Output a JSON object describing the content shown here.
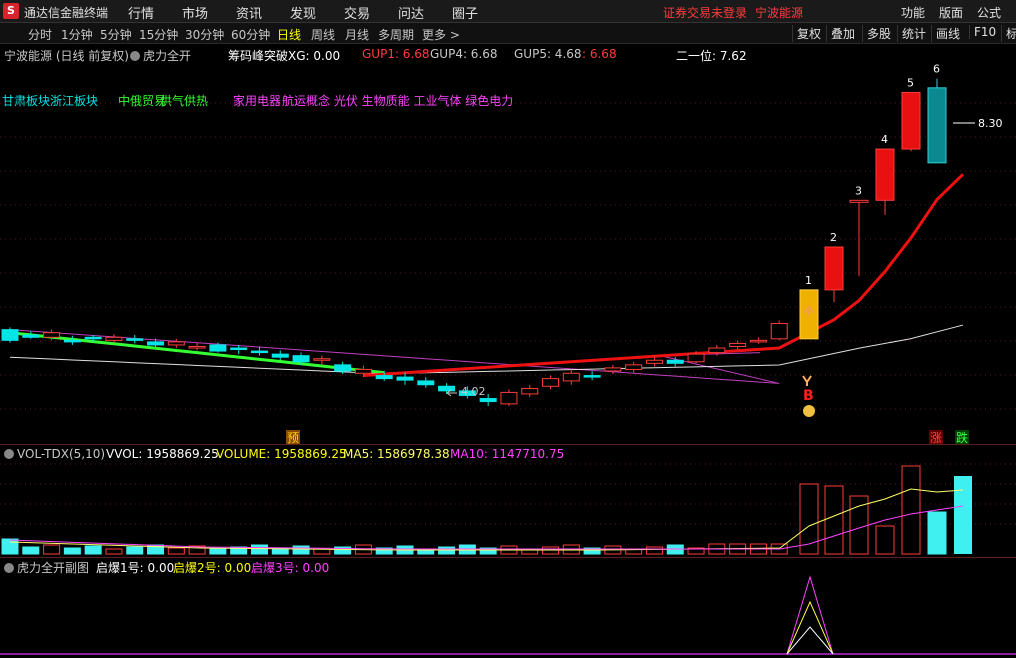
{
  "menubar": {
    "app_name": "通达信金融终端",
    "items": [
      "行情",
      "市场",
      "资讯",
      "发现",
      "交易",
      "问达",
      "圈子"
    ],
    "account_status": "证券交易未登录",
    "stock_name": "宁波能源",
    "right_items": [
      "功能",
      "版面",
      "公式"
    ]
  },
  "toolbar": {
    "periods": [
      "分时",
      "1分钟",
      "5分钟",
      "15分钟",
      "30分钟",
      "60分钟",
      "日线",
      "周线",
      "月线",
      "多周期",
      "更多 >"
    ],
    "active_period": "日线",
    "tools": [
      "复权",
      "叠加",
      "多股",
      "统计",
      "画线",
      "F10",
      "标"
    ]
  },
  "main_header": {
    "title": "宁波能源 (日线 前复权)",
    "indicator": "虎力全开",
    "xg": "筹码峰突破XG: 0.00",
    "gup1": "GUP1: 6.68",
    "gup4": "GUP4: 6.68",
    "gup5": "GUP5: 4.68",
    "extra": "6.68",
    "second": "二一位: 7.62"
  },
  "concepts": {
    "c1": "甘肃板块",
    "c2": "浙江板块",
    "c3": "中俄贸易",
    "c4": "供气供热",
    "c5": "家用电器",
    "c6": "航运概念 光伏 生物质能 工业气体 绿色电力"
  },
  "chart_labels": {
    "high_price": "8.30",
    "low_price": "4.02",
    "day_labels": [
      "1",
      "2",
      "3",
      "4",
      "5",
      "6"
    ],
    "buy_mark": "B",
    "yu_badge": "预",
    "zhang_badge": "涨",
    "die_badge": "跌"
  },
  "vol_header": {
    "name": "VOL-TDX(5,10)",
    "vvol": "VVOL: 1958869.25",
    "volume": "VOLUME: 1958869.25",
    "ma5": "MA5: 1586978.38",
    "ma10": "MA10: 1147710.75"
  },
  "sub_header": {
    "name": "虎力全开副图",
    "q1": "启爆1号: 0.00",
    "q2": "启爆2号: 0.00",
    "q3": "启爆3号: 0.00"
  },
  "chart_data": {
    "type": "candlestick",
    "x": [
      1,
      2,
      3,
      4,
      5,
      6,
      7,
      8,
      9,
      10,
      11,
      12,
      13,
      14,
      15,
      16,
      17,
      18,
      19,
      20,
      21,
      22,
      23,
      24,
      25,
      26,
      27,
      28,
      29,
      30,
      31,
      32,
      33,
      34,
      35,
      36,
      37,
      38
    ],
    "open": [
      5.02,
      4.95,
      4.92,
      4.88,
      4.92,
      4.88,
      4.9,
      4.86,
      4.82,
      4.78,
      4.82,
      4.78,
      4.74,
      4.7,
      4.68,
      4.62,
      4.56,
      4.45,
      4.42,
      4.4,
      4.35,
      4.28,
      4.22,
      4.12,
      4.05,
      4.18,
      4.28,
      4.35,
      4.42,
      4.48,
      4.5,
      4.58,
      4.62,
      4.6,
      4.72,
      4.8,
      4.86,
      4.9
    ],
    "close": [
      4.88,
      4.92,
      4.98,
      4.86,
      4.9,
      4.92,
      4.88,
      4.82,
      4.86,
      4.8,
      4.74,
      4.76,
      4.72,
      4.66,
      4.6,
      4.64,
      4.48,
      4.5,
      4.38,
      4.36,
      4.3,
      4.22,
      4.16,
      4.08,
      4.2,
      4.25,
      4.38,
      4.45,
      4.4,
      4.52,
      4.56,
      4.62,
      4.58,
      4.7,
      4.78,
      4.84,
      4.88,
      5.1
    ],
    "high": [
      5.05,
      5.0,
      5.02,
      4.94,
      4.95,
      4.96,
      4.95,
      4.9,
      4.9,
      4.85,
      4.85,
      4.82,
      4.8,
      4.75,
      4.72,
      4.68,
      4.6,
      4.55,
      4.48,
      4.46,
      4.4,
      4.32,
      4.28,
      4.18,
      4.24,
      4.3,
      4.42,
      4.5,
      4.48,
      4.56,
      4.6,
      4.68,
      4.66,
      4.74,
      4.82,
      4.88,
      4.92,
      5.14
    ],
    "low": [
      4.85,
      4.9,
      4.88,
      4.82,
      4.86,
      4.85,
      4.84,
      4.78,
      4.78,
      4.75,
      4.72,
      4.7,
      4.68,
      4.62,
      4.56,
      4.56,
      4.44,
      4.4,
      4.35,
      4.3,
      4.26,
      4.18,
      4.12,
      4.02,
      4.02,
      4.14,
      4.24,
      4.3,
      4.36,
      4.44,
      4.46,
      4.54,
      4.54,
      4.58,
      4.68,
      4.76,
      4.84,
      4.88
    ],
    "last_candles": [
      {
        "label": "1",
        "open": 4.9,
        "close": 5.54,
        "high": 5.54,
        "low": 4.9
      },
      {
        "label": "2",
        "open": 5.54,
        "close": 6.1,
        "high": 6.1,
        "low": 5.38
      },
      {
        "label": "3",
        "open": 6.71,
        "close": 6.71,
        "high": 6.71,
        "low": 5.72
      },
      {
        "label": "4",
        "open": 6.71,
        "close": 7.38,
        "high": 7.38,
        "low": 6.52
      },
      {
        "label": "5",
        "open": 7.38,
        "close": 8.12,
        "high": 8.12,
        "low": 7.35
      },
      {
        "label": "6",
        "open": 8.18,
        "close": 7.2,
        "high": 8.3,
        "low": 7.2
      }
    ],
    "ylim": [
      3.8,
      8.4
    ],
    "high_label": 8.3,
    "low_label": 4.02
  }
}
